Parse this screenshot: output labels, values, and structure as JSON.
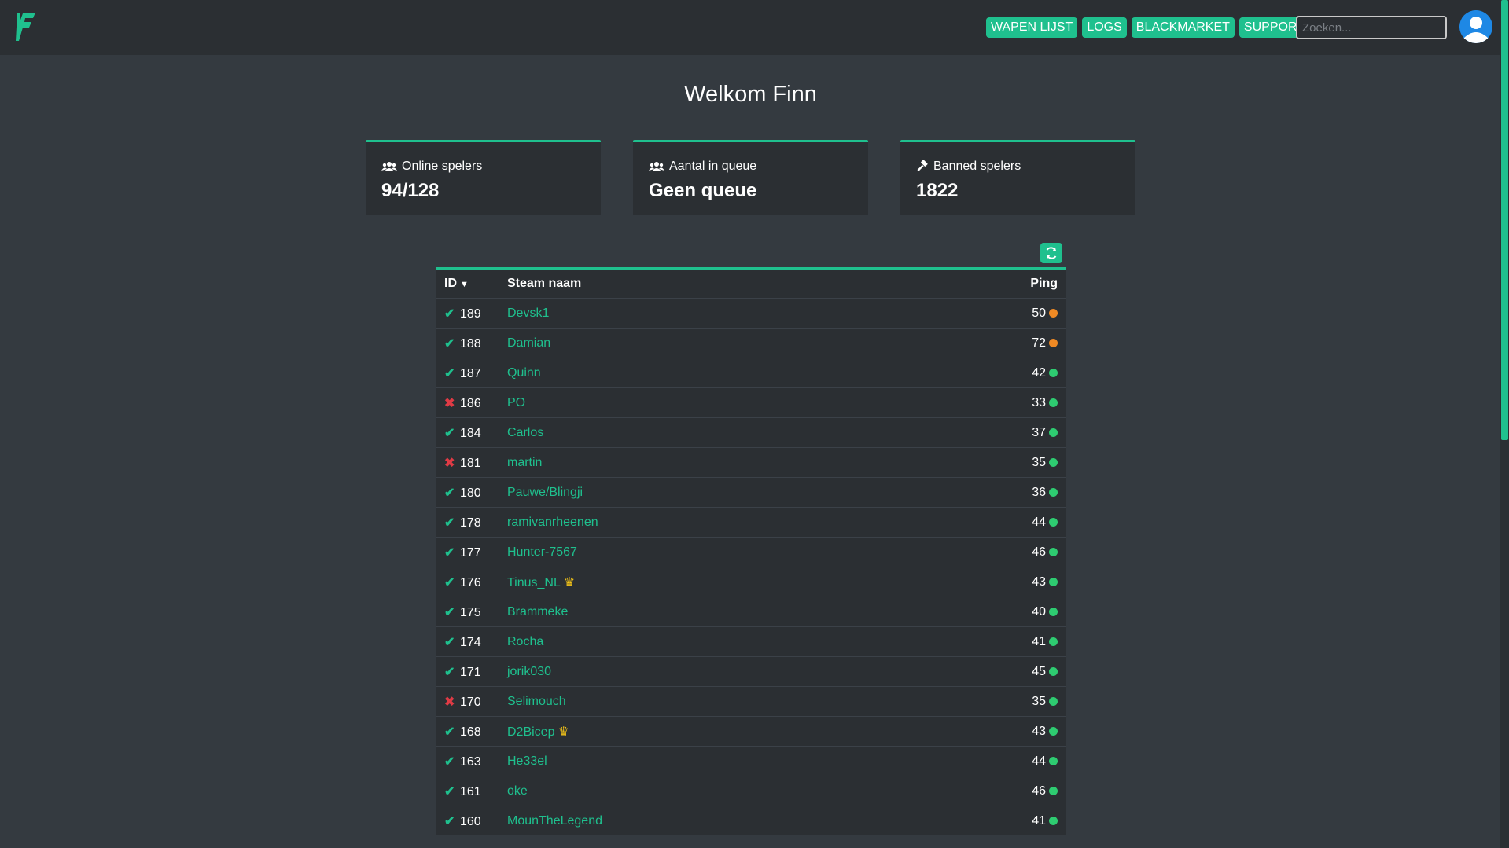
{
  "header": {
    "nav": [
      {
        "label": "WAPEN LIJST"
      },
      {
        "label": "LOGS"
      },
      {
        "label": "BLACKMARKET"
      },
      {
        "label": "SUPPORT"
      }
    ],
    "search_placeholder": "Zoeken..."
  },
  "welcome": "Welkom Finn",
  "cards": [
    {
      "label": "Online spelers",
      "value": "94/128",
      "icon": "users-icon"
    },
    {
      "label": "Aantal in queue",
      "value": "Geen queue",
      "icon": "users-icon"
    },
    {
      "label": "Banned spelers",
      "value": "1822",
      "icon": "gavel-icon"
    }
  ],
  "table": {
    "headers": {
      "id": "ID",
      "name": "Steam naam",
      "ping": "Ping"
    },
    "rows": [
      {
        "status": "ok",
        "id": "189",
        "name": "Devsk1",
        "ping": "50",
        "ping_color": "#f08a24",
        "crown": false
      },
      {
        "status": "ok",
        "id": "188",
        "name": "Damian",
        "ping": "72",
        "ping_color": "#f08a24",
        "crown": false
      },
      {
        "status": "ok",
        "id": "187",
        "name": "Quinn",
        "ping": "42",
        "ping_color": "#2ecc71",
        "crown": false
      },
      {
        "status": "bad",
        "id": "186",
        "name": "PO",
        "ping": "33",
        "ping_color": "#2ecc71",
        "crown": false
      },
      {
        "status": "ok",
        "id": "184",
        "name": "Carlos",
        "ping": "37",
        "ping_color": "#2ecc71",
        "crown": false
      },
      {
        "status": "bad",
        "id": "181",
        "name": "martin",
        "ping": "35",
        "ping_color": "#2ecc71",
        "crown": false
      },
      {
        "status": "ok",
        "id": "180",
        "name": "Pauwe/Blingji",
        "ping": "36",
        "ping_color": "#2ecc71",
        "crown": false
      },
      {
        "status": "ok",
        "id": "178",
        "name": "ramivanrheenen",
        "ping": "44",
        "ping_color": "#2ecc71",
        "crown": false
      },
      {
        "status": "ok",
        "id": "177",
        "name": "Hunter-7567",
        "ping": "46",
        "ping_color": "#2ecc71",
        "crown": false
      },
      {
        "status": "ok",
        "id": "176",
        "name": "Tinus_NL",
        "ping": "43",
        "ping_color": "#2ecc71",
        "crown": true
      },
      {
        "status": "ok",
        "id": "175",
        "name": "Brammeke",
        "ping": "40",
        "ping_color": "#2ecc71",
        "crown": false
      },
      {
        "status": "ok",
        "id": "174",
        "name": "Rocha",
        "ping": "41",
        "ping_color": "#2ecc71",
        "crown": false
      },
      {
        "status": "ok",
        "id": "171",
        "name": "jorik030",
        "ping": "45",
        "ping_color": "#2ecc71",
        "crown": false
      },
      {
        "status": "bad",
        "id": "170",
        "name": "Selimouch",
        "ping": "35",
        "ping_color": "#2ecc71",
        "crown": false
      },
      {
        "status": "ok",
        "id": "168",
        "name": "D2Bicep",
        "ping": "43",
        "ping_color": "#2ecc71",
        "crown": true
      },
      {
        "status": "ok",
        "id": "163",
        "name": "He33el",
        "ping": "44",
        "ping_color": "#2ecc71",
        "crown": false
      },
      {
        "status": "ok",
        "id": "161",
        "name": "oke",
        "ping": "46",
        "ping_color": "#2ecc71",
        "crown": false
      },
      {
        "status": "ok",
        "id": "160",
        "name": "MounTheLegend",
        "ping": "41",
        "ping_color": "#2ecc71",
        "crown": false
      }
    ]
  },
  "colors": {
    "accent": "#1fc08e",
    "background": "#343a40",
    "panel": "#2b2f33",
    "error": "#e03b45",
    "ping_warn": "#f08a24",
    "ping_good": "#2ecc71",
    "crown": "#f5c518"
  }
}
